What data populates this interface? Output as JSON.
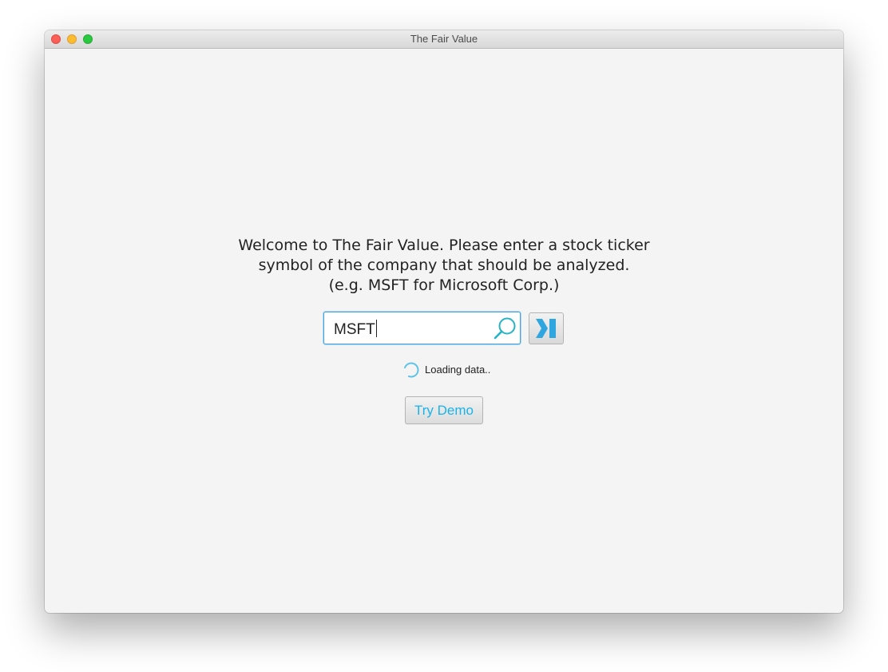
{
  "window": {
    "title": "The Fair Value"
  },
  "welcome": {
    "lines": [
      "Welcome to The Fair Value. Please enter a stock ticker",
      "symbol of the company that should be analyzed.",
      "(e.g. MSFT for Microsoft Corp.)"
    ]
  },
  "search": {
    "value": "MSFT",
    "icon": "search-icon"
  },
  "go_button": {
    "icon": "skip-forward-icon"
  },
  "status": {
    "icon": "spinner-icon",
    "text": "Loading data.."
  },
  "demo_button": {
    "label": "Try Demo"
  },
  "colors": {
    "accent": "#1ab3ea",
    "focus_border": "#4aa4dd",
    "background": "#f4f4f4"
  }
}
